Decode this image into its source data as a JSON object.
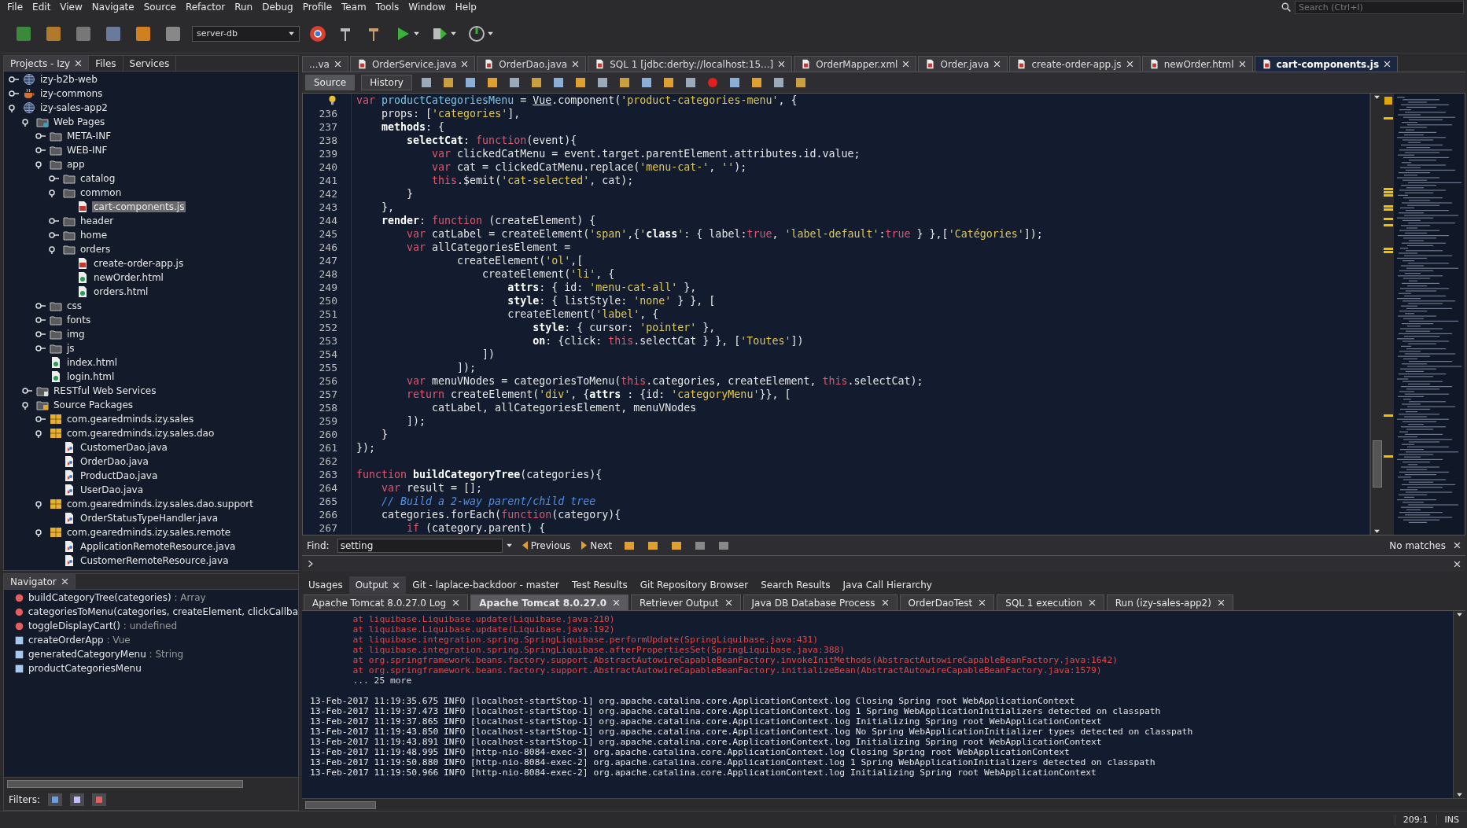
{
  "menu": [
    "File",
    "Edit",
    "View",
    "Navigate",
    "Source",
    "Refactor",
    "Run",
    "Debug",
    "Profile",
    "Team",
    "Tools",
    "Window",
    "Help"
  ],
  "search": {
    "placeholder": "Search (Ctrl+I)"
  },
  "toolbar": {
    "config": "server-db"
  },
  "projects": {
    "tabs": [
      {
        "label": "Projects - Izy",
        "selected": true
      },
      {
        "label": "Files",
        "selected": false
      },
      {
        "label": "Services",
        "selected": false
      }
    ],
    "tree": [
      {
        "label": "izy-b2b-web",
        "kind": "web-project",
        "expanded": false
      },
      {
        "label": "izy-commons",
        "kind": "java-project",
        "expanded": false
      },
      {
        "label": "izy-sales-app2",
        "kind": "web-project",
        "expanded": true,
        "children": [
          {
            "label": "Web Pages",
            "kind": "web-pages",
            "expanded": true,
            "children": [
              {
                "label": "META-INF",
                "kind": "folder",
                "expanded": false
              },
              {
                "label": "WEB-INF",
                "kind": "folder",
                "expanded": false
              },
              {
                "label": "app",
                "kind": "folder",
                "expanded": true,
                "children": [
                  {
                    "label": "catalog",
                    "kind": "folder",
                    "expanded": false
                  },
                  {
                    "label": "common",
                    "kind": "folder",
                    "expanded": true,
                    "children": [
                      {
                        "label": "cart-components.js",
                        "kind": "js",
                        "selected": true
                      }
                    ]
                  },
                  {
                    "label": "header",
                    "kind": "folder",
                    "expanded": false
                  },
                  {
                    "label": "home",
                    "kind": "folder",
                    "expanded": false
                  },
                  {
                    "label": "orders",
                    "kind": "folder",
                    "expanded": true,
                    "children": [
                      {
                        "label": "create-order-app.js",
                        "kind": "js",
                        "selected": false
                      },
                      {
                        "label": "newOrder.html",
                        "kind": "html",
                        "selected": false
                      },
                      {
                        "label": "orders.html",
                        "kind": "html",
                        "selected": false
                      }
                    ]
                  }
                ]
              },
              {
                "label": "css",
                "kind": "folder",
                "expanded": false
              },
              {
                "label": "fonts",
                "kind": "folder",
                "expanded": false
              },
              {
                "label": "img",
                "kind": "folder",
                "expanded": false
              },
              {
                "label": "js",
                "kind": "folder",
                "expanded": false
              },
              {
                "label": "index.html",
                "kind": "html",
                "selected": false
              },
              {
                "label": "login.html",
                "kind": "html",
                "selected": false
              }
            ]
          },
          {
            "label": "RESTful Web Services",
            "kind": "rest",
            "expanded": false
          },
          {
            "label": "Source Packages",
            "kind": "source",
            "expanded": true,
            "children": [
              {
                "label": "com.gearedminds.izy.sales",
                "kind": "package",
                "expanded": false
              },
              {
                "label": "com.gearedminds.izy.sales.dao",
                "kind": "package",
                "expanded": true,
                "children": [
                  {
                    "label": "CustomerDao.java",
                    "kind": "java",
                    "selected": false
                  },
                  {
                    "label": "OrderDao.java",
                    "kind": "java",
                    "selected": false
                  },
                  {
                    "label": "ProductDao.java",
                    "kind": "java",
                    "selected": false
                  },
                  {
                    "label": "UserDao.java",
                    "kind": "java",
                    "selected": false
                  }
                ]
              },
              {
                "label": "com.gearedminds.izy.sales.dao.support",
                "kind": "package",
                "expanded": true,
                "children": [
                  {
                    "label": "OrderStatusTypeHandler.java",
                    "kind": "java",
                    "selected": false
                  }
                ]
              },
              {
                "label": "com.gearedminds.izy.sales.remote",
                "kind": "package",
                "expanded": true,
                "children": [
                  {
                    "label": "ApplicationRemoteResource.java",
                    "kind": "java",
                    "selected": false
                  },
                  {
                    "label": "CustomerRemoteResource.java",
                    "kind": "java",
                    "selected": false
                  }
                ]
              }
            ]
          }
        ]
      }
    ]
  },
  "navigator": {
    "title": "Navigator",
    "items": [
      {
        "name": "buildCategoryTree(categories)",
        "type": " : Array",
        "kind": "function"
      },
      {
        "name": "categoriesToMenu(categories, createElement, clickCallba",
        "kind": "function"
      },
      {
        "name": "toggleDisplayCart()",
        "type": " : undefined",
        "kind": "function"
      },
      {
        "name": "createOrderApp",
        "type": " : Vue",
        "kind": "variable"
      },
      {
        "name": "generatedCategoryMenu",
        "type": " : String",
        "kind": "variable"
      },
      {
        "name": "productCategoriesMenu",
        "kind": "variable"
      }
    ],
    "filters_label": "Filters:"
  },
  "editor_tabs": [
    {
      "label": "...va",
      "selected": false
    },
    {
      "label": "OrderService.java",
      "selected": false
    },
    {
      "label": "OrderDao.java",
      "selected": false
    },
    {
      "label": "SQL 1 [jdbc:derby://localhost:15...]",
      "selected": false
    },
    {
      "label": "OrderMapper.xml",
      "selected": false
    },
    {
      "label": "Order.java",
      "selected": false
    },
    {
      "label": "create-order-app.js",
      "selected": false
    },
    {
      "label": "newOrder.html",
      "selected": false
    },
    {
      "label": "cart-components.js",
      "selected": true
    }
  ],
  "view_tabs": [
    {
      "label": "Source",
      "selected": true
    },
    {
      "label": "History",
      "selected": false
    }
  ],
  "code": [
    {
      "hint": true,
      "tokens": [
        {
          "kind": "keyword",
          "text": "var "
        },
        {
          "kind": "field",
          "text": "productCategoriesMenu"
        },
        {
          "kind": "plain",
          "text": " = "
        },
        {
          "kind": "underline",
          "text": "Vue"
        },
        {
          "kind": "plain",
          "text": ".component("
        },
        {
          "kind": "string",
          "text": "'product-categories-menu'"
        },
        {
          "kind": "plain",
          "text": ", {"
        }
      ]
    },
    {
      "number": "236",
      "tokens": [
        {
          "kind": "plain",
          "text": "    props: ["
        },
        {
          "kind": "string",
          "text": "'categories'"
        },
        {
          "kind": "plain",
          "text": "],"
        }
      ]
    },
    {
      "number": "237",
      "tokens": [
        {
          "kind": "bold",
          "text": "    methods"
        },
        {
          "kind": "plain",
          "text": ": {"
        }
      ]
    },
    {
      "number": "238",
      "tokens": [
        {
          "kind": "bold",
          "text": "        selectCat"
        },
        {
          "kind": "plain",
          "text": ": "
        },
        {
          "kind": "keyword",
          "text": "function"
        },
        {
          "kind": "plain",
          "text": "(event){"
        }
      ]
    },
    {
      "number": "239",
      "tokens": [
        {
          "kind": "keyword",
          "text": "            var "
        },
        {
          "kind": "plain",
          "text": "clickedCatMenu = event.target.parentElement.attributes.id.value;"
        }
      ]
    },
    {
      "number": "240",
      "tokens": [
        {
          "kind": "keyword",
          "text": "            var "
        },
        {
          "kind": "plain",
          "text": "cat = clickedCatMenu.replace("
        },
        {
          "kind": "string",
          "text": "'menu-cat-'"
        },
        {
          "kind": "plain",
          "text": ", "
        },
        {
          "kind": "string",
          "text": "''"
        },
        {
          "kind": "plain",
          "text": ");"
        }
      ]
    },
    {
      "number": "241",
      "tokens": [
        {
          "kind": "keyword",
          "text": "            this"
        },
        {
          "kind": "plain",
          "text": ".$emit("
        },
        {
          "kind": "string",
          "text": "'cat-selected'"
        },
        {
          "kind": "plain",
          "text": ", cat);"
        }
      ]
    },
    {
      "number": "242",
      "tokens": [
        {
          "kind": "plain",
          "text": "        }"
        }
      ]
    },
    {
      "number": "243",
      "tokens": [
        {
          "kind": "plain",
          "text": "    },"
        }
      ]
    },
    {
      "number": "244",
      "tokens": [
        {
          "kind": "bold",
          "text": "    render"
        },
        {
          "kind": "plain",
          "text": ": "
        },
        {
          "kind": "keyword",
          "text": "function"
        },
        {
          "kind": "plain",
          "text": " (createElement) {"
        }
      ]
    },
    {
      "number": "245",
      "tokens": [
        {
          "kind": "keyword",
          "text": "        var "
        },
        {
          "kind": "plain",
          "text": "catLabel = createElement("
        },
        {
          "kind": "string",
          "text": "'span'"
        },
        {
          "kind": "plain",
          "text": ",{"
        },
        {
          "kind": "string",
          "text": "'"
        },
        {
          "kind": "bold",
          "text": "class"
        },
        {
          "kind": "string",
          "text": "'"
        },
        {
          "kind": "plain",
          "text": ": { label:"
        },
        {
          "kind": "keyword",
          "text": "true"
        },
        {
          "kind": "plain",
          "text": ", "
        },
        {
          "kind": "string",
          "text": "'label-default'"
        },
        {
          "kind": "plain",
          "text": ":"
        },
        {
          "kind": "keyword",
          "text": "true"
        },
        {
          "kind": "plain",
          "text": " } },["
        },
        {
          "kind": "string",
          "text": "'Catégories'"
        },
        {
          "kind": "plain",
          "text": "]);"
        }
      ]
    },
    {
      "number": "246",
      "tokens": [
        {
          "kind": "keyword",
          "text": "        var "
        },
        {
          "kind": "plain",
          "text": "allCategoriesElement ="
        }
      ]
    },
    {
      "number": "247",
      "tokens": [
        {
          "kind": "plain",
          "text": "                createElement("
        },
        {
          "kind": "string",
          "text": "'ol'"
        },
        {
          "kind": "plain",
          "text": ",["
        }
      ]
    },
    {
      "number": "248",
      "tokens": [
        {
          "kind": "plain",
          "text": "                    createElement("
        },
        {
          "kind": "string",
          "text": "'li'"
        },
        {
          "kind": "plain",
          "text": ", {"
        }
      ]
    },
    {
      "number": "249",
      "tokens": [
        {
          "kind": "bold",
          "text": "                        attrs"
        },
        {
          "kind": "plain",
          "text": ": { id: "
        },
        {
          "kind": "string",
          "text": "'menu-cat-all'"
        },
        {
          "kind": "plain",
          "text": " },"
        }
      ]
    },
    {
      "number": "250",
      "tokens": [
        {
          "kind": "bold",
          "text": "                        style"
        },
        {
          "kind": "plain",
          "text": ": { listStyle: "
        },
        {
          "kind": "string",
          "text": "'none'"
        },
        {
          "kind": "plain",
          "text": " } }, ["
        }
      ]
    },
    {
      "number": "251",
      "tokens": [
        {
          "kind": "plain",
          "text": "                        createElement("
        },
        {
          "kind": "string",
          "text": "'label'"
        },
        {
          "kind": "plain",
          "text": ", {"
        }
      ]
    },
    {
      "number": "252",
      "tokens": [
        {
          "kind": "bold",
          "text": "                            style"
        },
        {
          "kind": "plain",
          "text": ": { cursor: "
        },
        {
          "kind": "string",
          "text": "'pointer'"
        },
        {
          "kind": "plain",
          "text": " },"
        }
      ]
    },
    {
      "number": "253",
      "tokens": [
        {
          "kind": "bold",
          "text": "                            on"
        },
        {
          "kind": "plain",
          "text": ": {click: "
        },
        {
          "kind": "keyword",
          "text": "this"
        },
        {
          "kind": "plain",
          "text": ".selectCat } }, ["
        },
        {
          "kind": "string",
          "text": "'Toutes'"
        },
        {
          "kind": "plain",
          "text": "])"
        }
      ]
    },
    {
      "number": "254",
      "tokens": [
        {
          "kind": "plain",
          "text": "                    ])"
        }
      ]
    },
    {
      "number": "255",
      "tokens": [
        {
          "kind": "plain",
          "text": "                ]);"
        }
      ]
    },
    {
      "number": "256",
      "tokens": [
        {
          "kind": "keyword",
          "text": "        var "
        },
        {
          "kind": "plain",
          "text": "menuVNodes = categoriesToMenu("
        },
        {
          "kind": "keyword",
          "text": "this"
        },
        {
          "kind": "plain",
          "text": ".categories, createElement, "
        },
        {
          "kind": "keyword",
          "text": "this"
        },
        {
          "kind": "plain",
          "text": ".selectCat);"
        }
      ]
    },
    {
      "number": "257",
      "tokens": [
        {
          "kind": "keyword",
          "text": "        return "
        },
        {
          "kind": "plain",
          "text": "createElement("
        },
        {
          "kind": "string",
          "text": "'div'"
        },
        {
          "kind": "plain",
          "text": ", {"
        },
        {
          "kind": "bold",
          "text": "attrs"
        },
        {
          "kind": "plain",
          "text": " : {id: "
        },
        {
          "kind": "string",
          "text": "'categoryMenu'"
        },
        {
          "kind": "plain",
          "text": "}}, ["
        }
      ]
    },
    {
      "number": "258",
      "tokens": [
        {
          "kind": "plain",
          "text": "            catLabel, allCategoriesElement, menuVNodes"
        }
      ]
    },
    {
      "number": "259",
      "tokens": [
        {
          "kind": "plain",
          "text": "        ]);"
        }
      ]
    },
    {
      "number": "260",
      "tokens": [
        {
          "kind": "plain",
          "text": "    }"
        }
      ]
    },
    {
      "number": "261",
      "tokens": [
        {
          "kind": "plain",
          "text": "});"
        }
      ]
    },
    {
      "number": "262"
    },
    {
      "number": "263",
      "tokens": [
        {
          "kind": "keyword",
          "text": "function "
        },
        {
          "kind": "bold",
          "text": "buildCategoryTree"
        },
        {
          "kind": "plain",
          "text": "(categories){"
        }
      ]
    },
    {
      "number": "264",
      "tokens": [
        {
          "kind": "keyword",
          "text": "    var "
        },
        {
          "kind": "plain",
          "text": "result = [];"
        }
      ]
    },
    {
      "number": "265",
      "tokens": [
        {
          "kind": "comment",
          "text": "    // Build a 2-way parent/child tree"
        }
      ]
    },
    {
      "number": "266",
      "tokens": [
        {
          "kind": "plain",
          "text": "    categories.forEach("
        },
        {
          "kind": "keyword",
          "text": "function"
        },
        {
          "kind": "plain",
          "text": "(category){"
        }
      ]
    },
    {
      "number": "267",
      "tokens": [
        {
          "kind": "keyword",
          "text": "        if "
        },
        {
          "kind": "plain",
          "text": "(category.parent) {"
        }
      ]
    }
  ],
  "find": {
    "label": "Find:",
    "value": "setting",
    "previous": "Previous",
    "next": "Next",
    "status": "No matches"
  },
  "output_tabs": [
    {
      "label": "Usages",
      "selected": false
    },
    {
      "label": "Output",
      "selected": true
    },
    {
      "label": "Git - laplace-backdoor - master",
      "selected": false
    },
    {
      "label": "Test Results",
      "selected": false
    },
    {
      "label": "Git Repository Browser",
      "selected": false
    },
    {
      "label": "Search Results",
      "selected": false
    },
    {
      "label": "Java Call Hierarchy",
      "selected": false
    }
  ],
  "output_subtabs": [
    {
      "label": "Apache Tomcat 8.0.27.0 Log",
      "selected": false
    },
    {
      "label": "Apache Tomcat 8.0.27.0",
      "selected": true
    },
    {
      "label": "Retriever Output",
      "selected": false
    },
    {
      "label": "Java DB Database Process",
      "selected": false
    },
    {
      "label": "OrderDaoTest",
      "selected": false
    },
    {
      "label": "SQL 1 execution",
      "selected": false
    },
    {
      "label": "Run (izy-sales-app2)",
      "selected": false
    }
  ],
  "log": [
    {
      "kind": "error",
      "text": "        at liquibase.Liquibase.update(Liquibase.java:210)"
    },
    {
      "kind": "error",
      "text": "        at liquibase.Liquibase.update(Liquibase.java:192)"
    },
    {
      "kind": "error",
      "text": "        at liquibase.integration.spring.SpringLiquibase.performUpdate(SpringLiquibase.java:431)"
    },
    {
      "kind": "error",
      "text": "        at liquibase.integration.spring.SpringLiquibase.afterPropertiesSet(SpringLiquibase.java:388)"
    },
    {
      "kind": "error",
      "text": "        at org.springframework.beans.factory.support.AbstractAutowireCapableBeanFactory.invokeInitMethods(AbstractAutowireCapableBeanFactory.java:1642)"
    },
    {
      "kind": "error",
      "text": "        at org.springframework.beans.factory.support.AbstractAutowireCapableBeanFactory.initializeBean(AbstractAutowireCapableBeanFactory.java:1579)"
    },
    {
      "kind": "note",
      "text": "        ... 25 more"
    },
    {
      "kind": "info",
      "text": "13-Feb-2017 11:19:35.675 INFO [localhost-startStop-1] org.apache.catalina.core.ApplicationContext.log Closing Spring root WebApplicationContext"
    },
    {
      "kind": "info",
      "text": "13-Feb-2017 11:19:37.473 INFO [localhost-startStop-1] org.apache.catalina.core.ApplicationContext.log 1 Spring WebApplicationInitializers detected on classpath"
    },
    {
      "kind": "info",
      "text": "13-Feb-2017 11:19:37.865 INFO [localhost-startStop-1] org.apache.catalina.core.ApplicationContext.log Initializing Spring root WebApplicationContext"
    },
    {
      "kind": "info",
      "text": "13-Feb-2017 11:19:43.850 INFO [localhost-startStop-1] org.apache.catalina.core.ApplicationContext.log No Spring WebApplicationInitializer types detected on classpath"
    },
    {
      "kind": "info",
      "text": "13-Feb-2017 11:19:43.891 INFO [localhost-startStop-1] org.apache.catalina.core.ApplicationContext.log Initializing Spring root WebApplicationContext"
    },
    {
      "kind": "info",
      "text": "13-Feb-2017 11:19:48.995 INFO [http-nio-8084-exec-3] org.apache.catalina.core.ApplicationContext.log Closing Spring root WebApplicationContext"
    },
    {
      "kind": "info",
      "text": "13-Feb-2017 11:19:50.880 INFO [http-nio-8084-exec-2] org.apache.catalina.core.ApplicationContext.log 1 Spring WebApplicationInitializers detected on classpath"
    },
    {
      "kind": "info",
      "text": "13-Feb-2017 11:19:50.966 INFO [http-nio-8084-exec-2] org.apache.catalina.core.ApplicationContext.log Initializing Spring root WebApplicationContext"
    }
  ],
  "status_bar": {
    "position": "209:1",
    "mode": "INS"
  }
}
